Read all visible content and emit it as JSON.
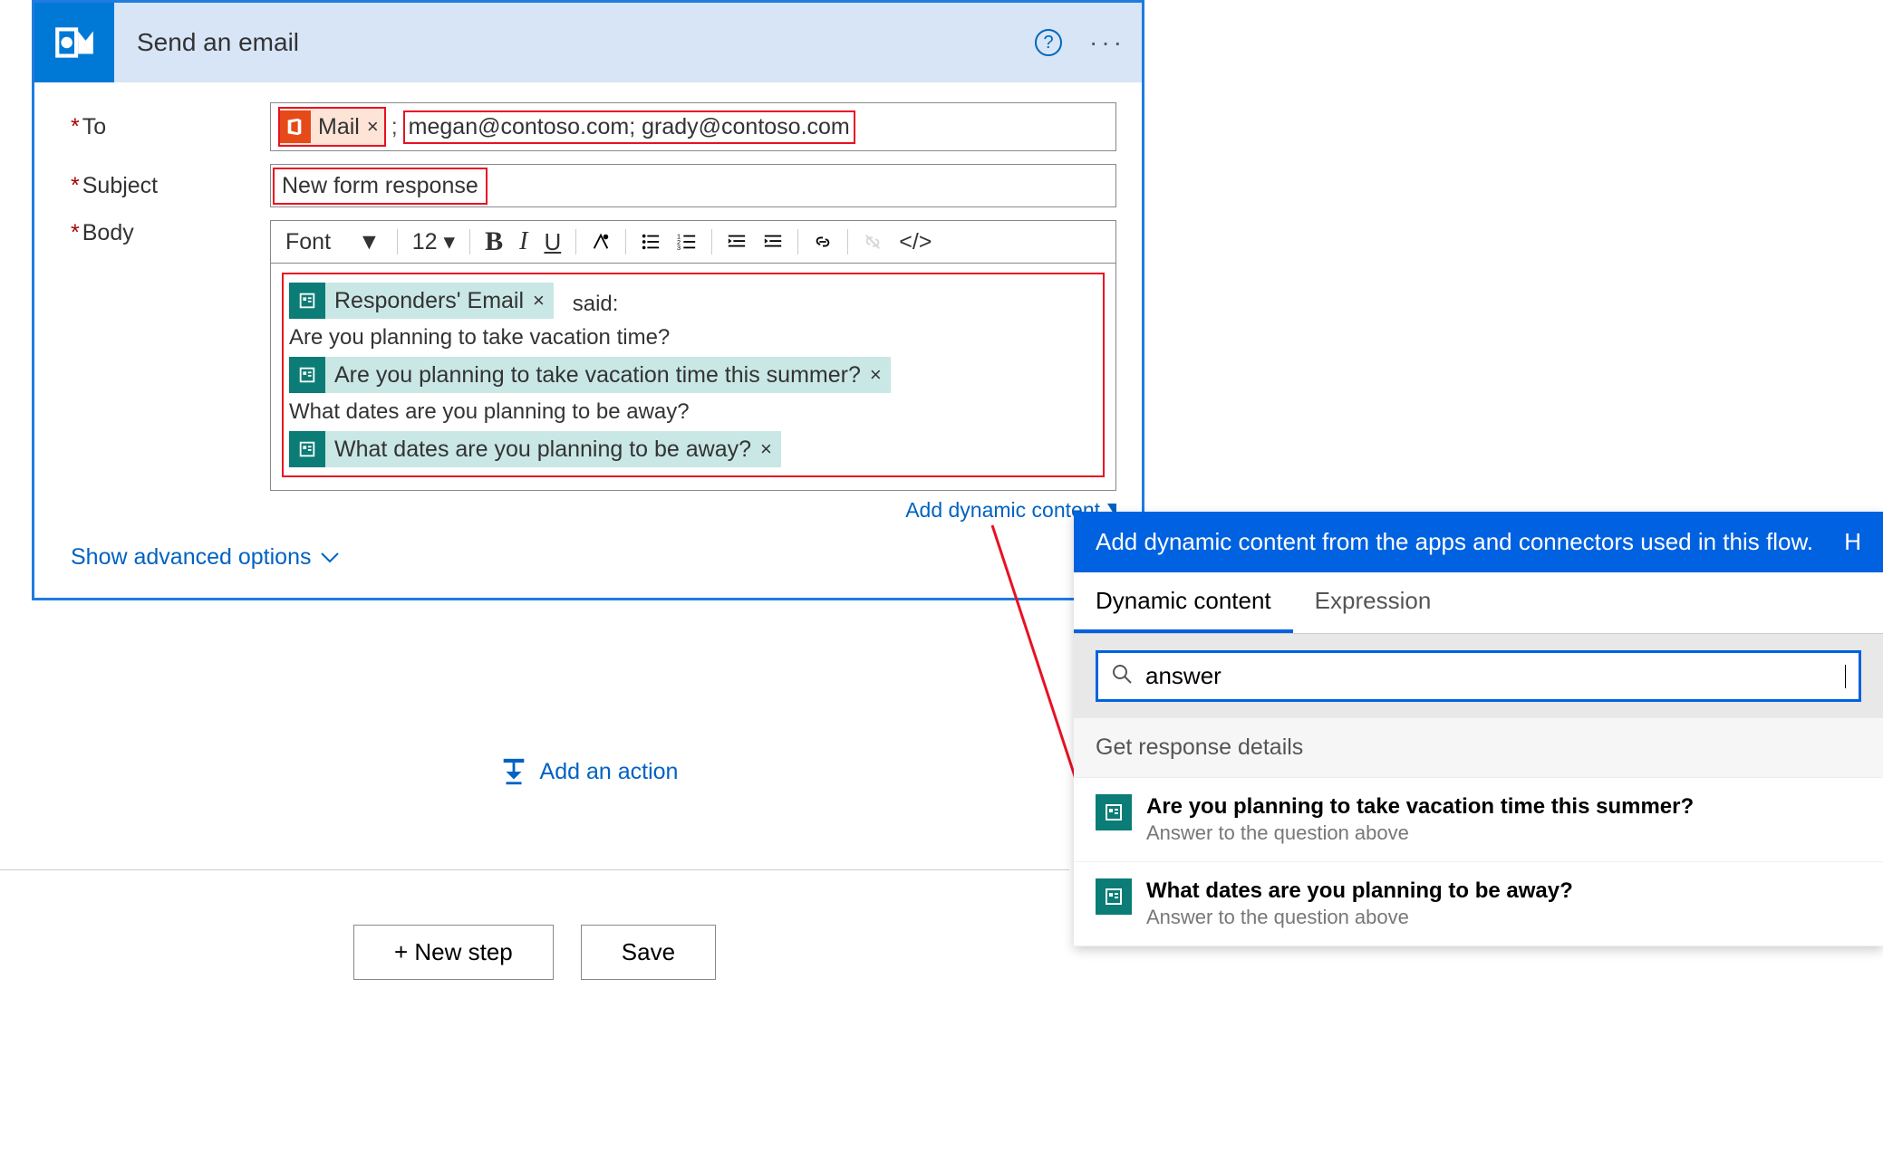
{
  "card": {
    "title": "Send an email",
    "help_label": "?",
    "more_label": "···"
  },
  "fields": {
    "to_label": "To",
    "subject_label": "Subject",
    "body_label": "Body"
  },
  "to": {
    "mail_token": "Mail",
    "value": "megan@contoso.com; grady@contoso.com"
  },
  "subject": {
    "value": "New form response"
  },
  "toolbar": {
    "font_label": "Font",
    "size_label": "12"
  },
  "body": {
    "said": "said:",
    "token_responders": "Responders' Email",
    "line_q1": "Are you planning to take vacation time?",
    "token_q1": "Are you planning to take vacation time this summer?",
    "line_q2": "What dates are you planning to be away?",
    "token_q2": "What dates are you planning to be away?"
  },
  "add_dynamic": "Add dynamic content",
  "adv_options": "Show advanced options",
  "add_action": "Add an action",
  "footer": {
    "new_step": "+ New step",
    "save": "Save"
  },
  "dyn": {
    "header": "Add dynamic content from the apps and connectors used in this flow.",
    "header_right": "H",
    "tab_dynamic": "Dynamic content",
    "tab_expression": "Expression",
    "search_value": "answer",
    "section": "Get response details",
    "items": [
      {
        "title": "Are you planning to take vacation time this summer?",
        "desc": "Answer to the question above"
      },
      {
        "title": "What dates are you planning to be away?",
        "desc": "Answer to the question above"
      }
    ]
  }
}
